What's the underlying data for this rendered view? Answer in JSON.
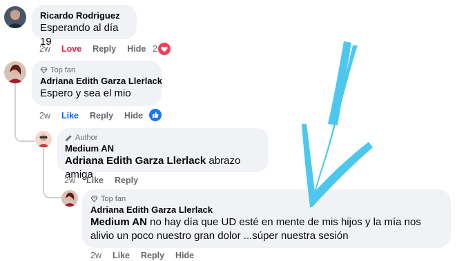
{
  "comments": [
    {
      "author": "Ricardo Rodriguez",
      "text": "Esperando al día 19",
      "time": "2w",
      "reaction_label": "Love",
      "reply_label": "Reply",
      "hide_label": "Hide",
      "reaction_count": "2",
      "reaction_icon": "heart-icon",
      "colors": {
        "reaction": "#e41e3f"
      }
    },
    {
      "badge": "Top fan",
      "author": "Adriana Edith Garza Llerlack",
      "text": "Espero y sea el mio",
      "time": "2w",
      "reaction_label": "Like",
      "reply_label": "Reply",
      "hide_label": "Hide",
      "reaction_icon": "thumbs-up-icon",
      "colors": {
        "reaction": "#0866ff"
      }
    },
    {
      "badge": "Author",
      "author": "Medium AN",
      "mention": "Adriana Edith Garza Llerlack",
      "text": " abrazo amiga",
      "time": "2w",
      "reaction_label": "Like",
      "reply_label": "Reply"
    },
    {
      "badge": "Top fan",
      "author": "Adriana Edith Garza Llerlack",
      "mention": "Medium AN",
      "text": " no hay día que UD esté en mente de mis hijos y la mía nos alivio un poco nuestro gran dolor ...súper nuestra sesión",
      "time": "2w",
      "reaction_label": "Like",
      "reply_label": "Reply",
      "hide_label": "Hide"
    }
  ],
  "annotation": {
    "shape": "hand-drawn-arrow",
    "color": "#4cc8ef"
  }
}
